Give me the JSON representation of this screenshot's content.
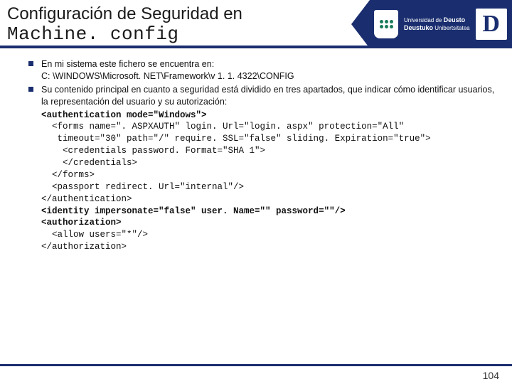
{
  "header": {
    "title_line1": "Configuración de Seguridad en",
    "title_line2": "Machine. config",
    "university": {
      "line1": "Universidad de",
      "line1b": "Deusto",
      "line2": "Deustuko",
      "line2b": "Unibertsitatea",
      "d": "D"
    }
  },
  "bullets": {
    "b1a": "En mi sistema este fichero se encuentra en:",
    "b1b": "C: \\WINDOWS\\Microsoft. NET\\Framework\\v 1. 1. 4322\\CONFIG",
    "b2": "Su contenido principal en cuanto a seguridad está dividido en tres apartados, que indicar cómo identificar usuarios, la representación del usuario y su autorización:"
  },
  "code": {
    "l1": "<authentication mode=\"Windows\">",
    "l2": "  <forms name=\". ASPXAUTH\" login. Url=\"login. aspx\" protection=\"All\"",
    "l3": "   timeout=\"30\" path=\"/\" require. SSL=\"false\" sliding. Expiration=\"true\">",
    "l4": "    <credentials password. Format=\"SHA 1\">",
    "l5": "    </credentials>",
    "l6": "  </forms>",
    "l7": "  <passport redirect. Url=\"internal\"/>",
    "l8": "</authentication>",
    "l9": "<identity impersonate=\"false\" user. Name=\"\" password=\"\"/>",
    "l10": "<authorization>",
    "l11": "  <allow users=\"*\"/>",
    "l12": "</authorization>"
  },
  "footer": {
    "page": "104"
  }
}
